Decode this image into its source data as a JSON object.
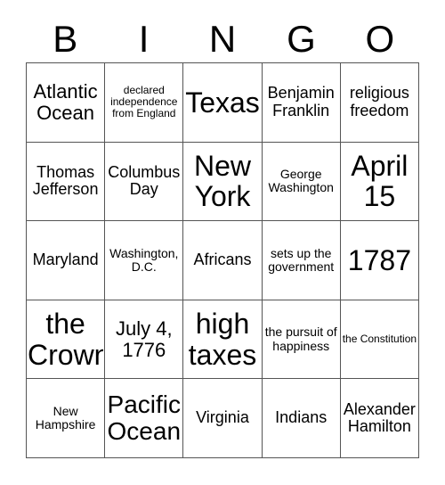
{
  "card": {
    "title_letters": [
      "B",
      "I",
      "N",
      "G",
      "O"
    ],
    "rows": [
      [
        {
          "text": "Atlantic Ocean",
          "size": "lg"
        },
        {
          "text": "declared independence from England",
          "size": "xs"
        },
        {
          "text": "Texas",
          "size": "xxl"
        },
        {
          "text": "Benjamin Franklin",
          "size": "md"
        },
        {
          "text": "religious freedom",
          "size": "md"
        }
      ],
      [
        {
          "text": "Thomas Jefferson",
          "size": "md"
        },
        {
          "text": "Columbus Day",
          "size": "md"
        },
        {
          "text": "New York",
          "size": "xxl"
        },
        {
          "text": "George Washington",
          "size": "sm"
        },
        {
          "text": "April 15",
          "size": "xxl"
        }
      ],
      [
        {
          "text": "Maryland",
          "size": "md"
        },
        {
          "text": "Washington, D.C.",
          "size": "sm"
        },
        {
          "text": "Africans",
          "size": "md"
        },
        {
          "text": "sets up the government",
          "size": "sm"
        },
        {
          "text": "1787",
          "size": "xxl"
        }
      ],
      [
        {
          "text": "the Crown",
          "size": "xxl"
        },
        {
          "text": "July 4, 1776",
          "size": "lg"
        },
        {
          "text": "high taxes",
          "size": "xxl"
        },
        {
          "text": "the pursuit of happiness",
          "size": "sm"
        },
        {
          "text": "the Constitution",
          "size": "xs"
        }
      ],
      [
        {
          "text": "New Hampshire",
          "size": "sm"
        },
        {
          "text": "Pacific Ocean",
          "size": "xl"
        },
        {
          "text": "Virginia",
          "size": "md"
        },
        {
          "text": "Indians",
          "size": "md"
        },
        {
          "text": "Alexander Hamilton",
          "size": "md"
        }
      ]
    ]
  },
  "colors": {
    "background": "#ffffff",
    "text": "#000000",
    "grid_line": "#555555"
  }
}
